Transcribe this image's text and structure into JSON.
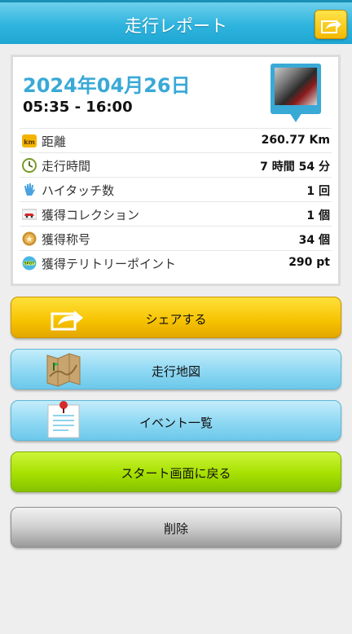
{
  "header": {
    "title": "走行レポート",
    "share_icon": "share-arrow-icon"
  },
  "report": {
    "date": "2024年04月26日",
    "time_range": "05:35 - 16:00",
    "photo_icon": "photo-pin-icon",
    "stats": [
      {
        "icon": "km-badge-icon",
        "label": "距離",
        "value": "260.77 Km"
      },
      {
        "icon": "clock-icon",
        "label": "走行時間",
        "value": "7 時間 54 分"
      },
      {
        "icon": "high-five-hand-icon",
        "label": "ハイタッチ数",
        "value": "1 回"
      },
      {
        "icon": "car-card-icon",
        "label": "獲得コレクション",
        "value": "1 個"
      },
      {
        "icon": "medal-icon",
        "label": "獲得称号",
        "value": "34 個"
      },
      {
        "icon": "spot-badge-icon",
        "label": "獲得テリトリーポイント",
        "value": "290 pt"
      }
    ]
  },
  "buttons": {
    "share": "シェアする",
    "map": "走行地図",
    "events": "イベント一覧",
    "back_to_start": "スタート画面に戻る",
    "delete": "削除"
  },
  "colors": {
    "header": "#2fb4de",
    "date_text": "#39a9d6",
    "share_button": "#f6c200",
    "blue_button": "#8ed8f3",
    "green_button": "#a6e000",
    "gray_button": "#cfcfcf"
  }
}
